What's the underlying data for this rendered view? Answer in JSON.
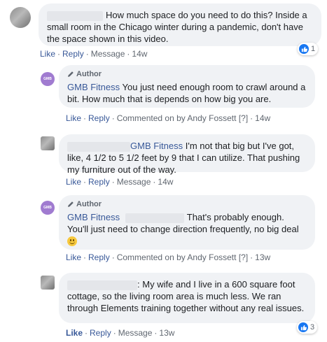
{
  "comments": [
    {
      "text": "How much space do you need to do this? Inside a small room in the Chicago winter during a pandemic, don't have the space shown in this video.",
      "actions": {
        "like": "Like",
        "reply": "Reply",
        "message": "Message",
        "time": "14w"
      },
      "reactions": "1"
    },
    {
      "author_tag": "Author",
      "author": "GMB Fitness",
      "avatar_text": "GMB",
      "text": "You just need enough room to crawl around a bit. How much that is depends on how big you are.",
      "actions": {
        "like": "Like",
        "reply": "Reply",
        "commented_by": "Commented on by Andy Fossett",
        "qmark": "[?]",
        "time": "14w"
      }
    },
    {
      "mention": "GMB Fitness",
      "text": "I'm not that big but I've got, like, 4 1/2 to 5 1/2 feet by 9 that I can utilize. That pushing my furniture out of the way.",
      "actions": {
        "like": "Like",
        "reply": "Reply",
        "message": "Message",
        "time": "14w"
      }
    },
    {
      "author_tag": "Author",
      "author": "GMB Fitness",
      "avatar_text": "GMB",
      "text": "That's probably enough. You'll just need to change direction frequently, no big deal",
      "actions": {
        "like": "Like",
        "reply": "Reply",
        "commented_by": "Commented on by Andy Fossett",
        "qmark": "[?]",
        "time": "13w"
      }
    },
    {
      "text_prefix": ":",
      "text": "My wife and I live in a 600 square foot cottage, so the living room area is much less. We ran through Elements training together without any real issues.",
      "actions": {
        "like": "Like",
        "reply": "Reply",
        "message": "Message",
        "time": "13w"
      },
      "reactions": "3"
    }
  ],
  "icons": {
    "pencil": "pencil-icon",
    "like_reaction": "thumbs-up-icon",
    "smile": "smile-emoji-icon"
  },
  "colors": {
    "link": "#385898",
    "bubble": "#f0f2f5",
    "like_blue": "#1877f2",
    "meta_gray": "#606770"
  }
}
